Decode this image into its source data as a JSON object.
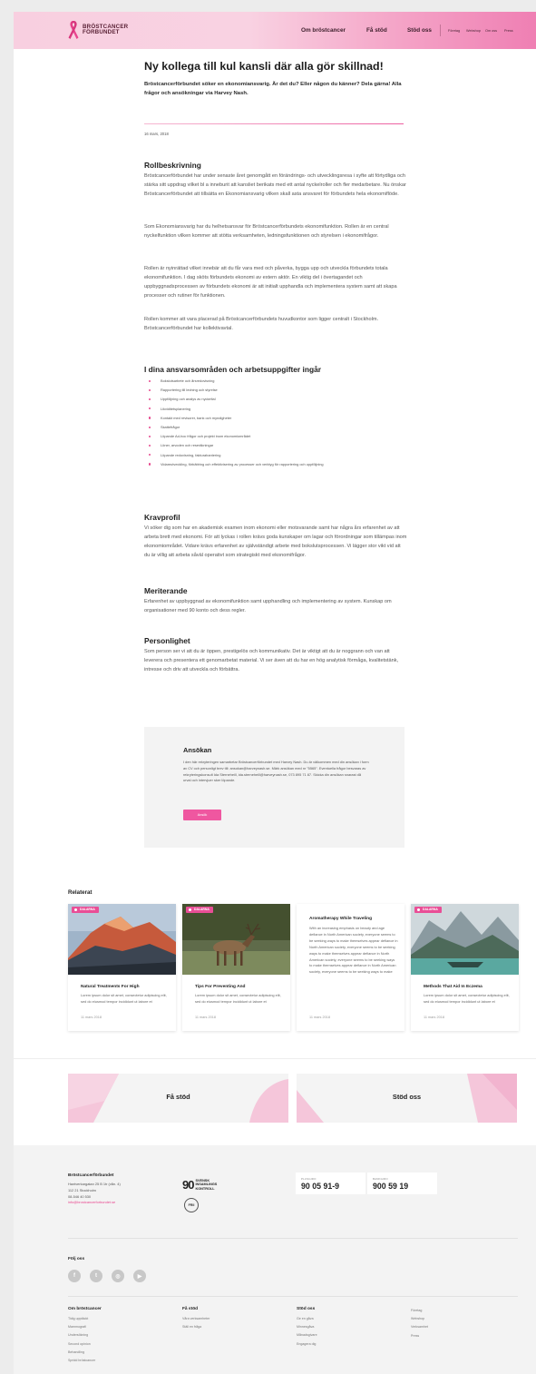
{
  "header": {
    "logo_line1": "BRÖSTCANCER",
    "logo_line2": "FÖRBUNDET",
    "main_nav": [
      "Om bröstcancer",
      "Få stöd",
      "Stöd oss"
    ],
    "sub_nav": [
      "Företag",
      "Webshop",
      "Om oss",
      "Press"
    ]
  },
  "article": {
    "title": "Ny kollega till kul kansli där alla gör skillnad!",
    "lead": "Bröstcancerförbundet söker en ekonomiansvarig. Är det du? Eller någon du känner? Dela gärna! Alla frågor och ansökningar via Harvey Nash.",
    "date": "16 mars, 2018",
    "roll_heading": "Rollbeskrivning",
    "roll_p1": "Bröstcancerförbundet har under senaste året genomgått en förändrings- och utvecklingsresa i syfte att förtydliga och stärka sitt uppdrag vilket bl a inneburit att kansliet berikats med ett antal nyckelroller och fler medarbetare. Nu önskar Bröstcancerförbundet att tillsätta en Ekonomiansvarig vilken skall asta ansvaret för förbundets hela ekonomiflöde.",
    "roll_p2": "Som Ekonomiansvarig har du helhetsansvar för Bröstcancerförbundets ekonomifunktion. Rollen är en central nyckelfunktion vilken kommer att stötta verksamheten, ledningsfunktionen och styrelsen i ekonomifrågor.",
    "roll_p3": "Rollen är nyinrättad vilket innebär att du får vara med och påverka, bygga upp och utveckla förbundets totala ekonomifunktion. I dag sköts förbundets ekonomi av extern aktör. En viktig del i övertagandet och uppbyggnadsprocessen av förbundets ekonomi är att initialt upphandla och implementera system samt att skapa processer och rutiner för funktionen.",
    "roll_p4": "Rollen kommer att vara placerad på Bröstcancerförbundets huvudkontor som ligger centralt i Stockholm. Bröstcancerförbundet har kollektivavtal.",
    "duties_heading": "I dina ansvarsområden och arbetsuppgifter ingår",
    "duties": [
      "Bokslutsarbete och årsredovisning",
      "Rapportering till ledning och styrelse",
      "Uppföljning och analys av nyckeltal",
      "Likviditetsplanering",
      "Kontakt med revisorer, bank och myndigheter",
      "Skattefrågor",
      "Löpande Ad-hoc frågor och projekt inom ekonomiområdet",
      "Löner, arvoden och reseräkningar",
      "Löpande redovisning, fakturahantering",
      "Vidareutveckling, förbättring och effektivisering av processer och verktyg för rapportering och uppföljning"
    ],
    "krav_heading": "Kravprofil",
    "krav_p": "Vi söker dig som har en akademisk examen inom ekonomi eller motsvarande samt har några års erfarenhet av att arbeta brett med ekonomi. För att lyckas i rollen krävs goda kunskaper om lagar och förordningar som tillämpas inom ekonomiområdet. Vidare krävs erfarenhet av självständigt arbete med bokslutsprocessen. Vi lägger stor vikt vid att du är villig att arbeta såväl operativt som strategiskt med ekonomifrågor.",
    "merit_heading": "Meriterande",
    "merit_p": "Erfarenhet av uppbyggnad av ekonomifunktion samt upphandling och implementering av system. Kunskap om organisationer med 90 konto och dess regler.",
    "pers_heading": "Personlighet",
    "pers_p": "Som person ser vi att du är öppen, prestigelös och kommunikativ. Det är viktigt att du är noggrann och van att leverera och presentera ett genomarbetat material. Vi ser även att du har en hög analytisk förmåga, kvalitetstänk, intresse och driv att utveckla och förbättra."
  },
  "apply": {
    "heading": "Ansökan",
    "text": "I den här rekryteringen samarbetar Bröstcancerförbundet med Harvey Nash. Du är välkommen med din ansökan i form av CV och personligt brev till: ansokan@harveynash.se. Märk ansökan med nr \"5565\". Eventuella frågor besvaras av rekryteringskonsult Ida Sterneheill, ida.sterneheill@harveynash.se, 073 895 71 87. Skicka din ansökan snarast då urval och intervjuer sker löpande.",
    "button": "Ansök"
  },
  "related": {
    "heading": "Relaterat",
    "cards": [
      {
        "tag": "DALARNA",
        "title": "Natural Treatments For High",
        "text": "Lorem ipsum dolor sit amet, consectetur adipiscing elit, sed do eiusmod tempor incididunt ut labore et",
        "date": "11 mars 2018"
      },
      {
        "tag": "DALARNA",
        "title": "Tips For Preventing And",
        "text": "Lorem ipsum dolor sit amet, consectetur adipiscing elit, sed do eiusmod tempor incididunt ut labore et",
        "date": "11 mars 2018"
      },
      {
        "title": "Aromatherapy While Traveling",
        "text": "With an increasing emphasis on beauty and age defiance in North American society, everyone seems to be seeking ways to make themselves appear defiance in North American society, everyone seems to be seeking ways to make themselves appear defiance in North American society, everyone seems to be seeking ways to make themselves appear defiance in North American society, everyone seems to be seeking ways to make",
        "date": "11 mars 2018"
      },
      {
        "tag": "DALARNA",
        "title": "Methods That Aid In Eczema",
        "text": "Lorem ipsum dolor sit amet, consectetur adipiscing elit, sed do eiusmod tempor incididunt ut labore et",
        "date": "11 mars 2018"
      }
    ]
  },
  "banners": [
    "Få stöd",
    "Stöd oss"
  ],
  "footer": {
    "org": "Bröstcancerförbundet",
    "address": [
      "Hantverkargatan 25 B 1tr (vån. 4)",
      "112 21 Stockholm",
      "08-546 40 530"
    ],
    "email": "info@brostcancerforbundet.se",
    "nk_number": "90",
    "nk_text": [
      "SVENSK",
      "INSAMLINGS",
      "KONTROLL"
    ],
    "frii": "FRII",
    "plusgiro_label": "PLUSGIRO",
    "plusgiro": "90 05 91-9",
    "bankgiro_label": "BANKGIRO",
    "bankgiro": "900 59 19",
    "follow": "Följ oss",
    "social": [
      "f",
      "t",
      "◎",
      "▶"
    ],
    "social_icons": [
      "facebook-icon",
      "twitter-icon",
      "instagram-icon",
      "youtube-icon"
    ],
    "columns": [
      {
        "heading": "Om bröstcancer",
        "items": [
          "Tidig upptäckt",
          "Mammografi",
          "Undersökning",
          "Second opinion",
          "Behandling",
          "Spridd bröstcancer"
        ]
      },
      {
        "heading": "Få stöd",
        "items": [
          "Våra verksamheter",
          "Ställ en fråga"
        ]
      },
      {
        "heading": "Stöd oss",
        "items": [
          "Ge en gåva",
          "Minnesgåva",
          "Månadsgivare",
          "Engagera dig"
        ]
      },
      {
        "heading": "",
        "items": [
          "Företag",
          "Webshop",
          "Verksamhet",
          "Press"
        ]
      }
    ]
  },
  "colors": {
    "accent": "#e9468f",
    "header_start": "#f8cfe0",
    "header_end": "#ef7fb3"
  }
}
